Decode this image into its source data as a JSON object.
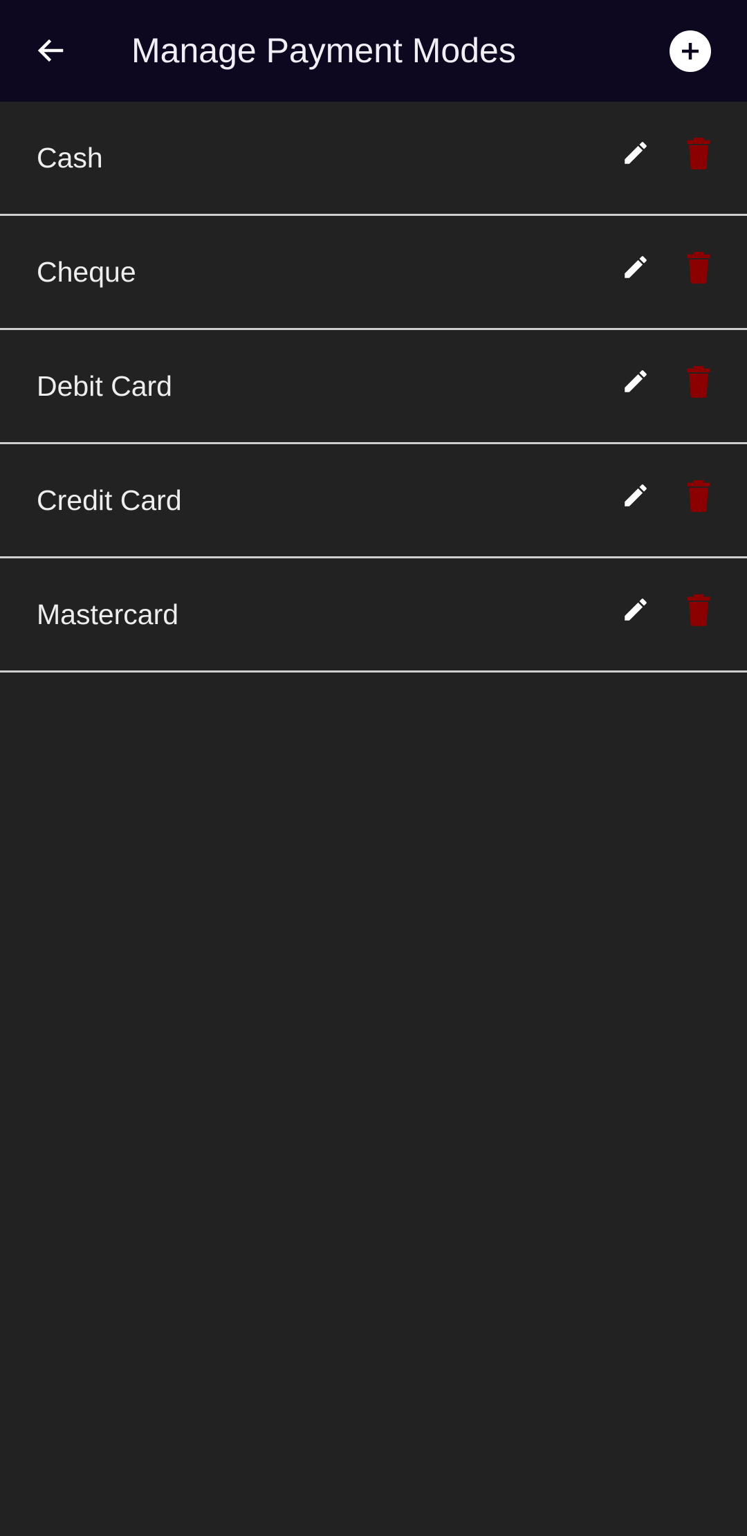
{
  "header": {
    "title": "Manage Payment Modes",
    "back_icon": "arrow-left-icon",
    "add_icon": "plus-circle-icon"
  },
  "payment_modes": [
    {
      "label": "Cash"
    },
    {
      "label": "Cheque"
    },
    {
      "label": "Debit Card"
    },
    {
      "label": "Credit Card"
    },
    {
      "label": "Mastercard"
    }
  ],
  "row_actions": {
    "edit_icon": "pencil-icon",
    "delete_icon": "trash-icon"
  },
  "colors": {
    "app_bar": "#0d0820",
    "background": "#222222",
    "text": "#eeeeee",
    "divider": "#cfcfcf",
    "delete": "#8b0000",
    "edit": "#ffffff"
  }
}
